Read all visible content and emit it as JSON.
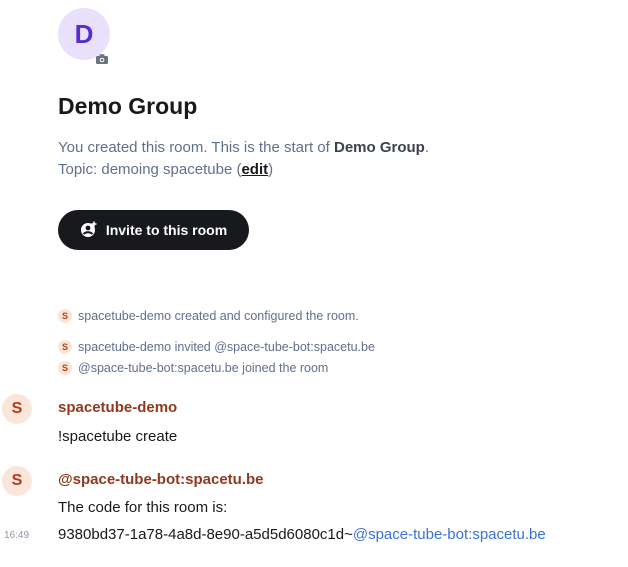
{
  "room": {
    "avatar_letter": "D",
    "name": "Demo Group",
    "intro_prefix": "You created this room. This is the start of ",
    "intro_room_name": "Demo Group",
    "intro_suffix": ".",
    "topic_prefix": "Topic: demoing spacetube (",
    "topic_edit": "edit",
    "topic_suffix": ")",
    "invite_label": "Invite to this room"
  },
  "events": [
    {
      "avatar": "S",
      "text": "spacetube-demo created and configured the room."
    },
    {
      "avatar": "S",
      "text": "spacetube-demo invited @space-tube-bot:spacetu.be"
    },
    {
      "avatar": "S",
      "text": "@space-tube-bot:spacetu.be joined the room"
    }
  ],
  "messages": [
    {
      "avatar": "S",
      "sender": "spacetube-demo",
      "body": "!spacetube create"
    },
    {
      "avatar": "S",
      "sender": "@space-tube-bot:spacetu.be",
      "body": "The code for this room is:",
      "body2_prefix": "9380bd37-1a78-4a8d-8e90-a5d5d6080c1d~",
      "body2_mention": "@space-tube-bot:spacetu.be",
      "timestamp": "16:49"
    }
  ]
}
